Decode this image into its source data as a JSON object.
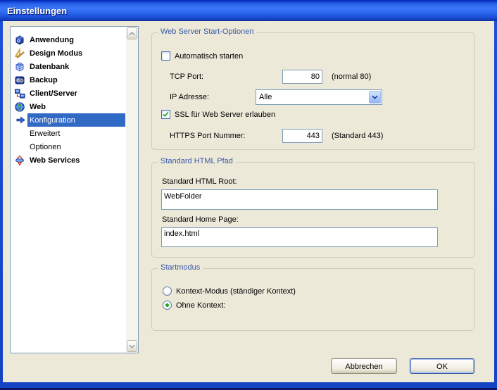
{
  "window": {
    "title": "Einstellungen"
  },
  "sidebar": {
    "items": [
      {
        "label": "Anwendung",
        "icon": "application-cube-icon",
        "level": 0,
        "selected": false
      },
      {
        "label": "Design Modus",
        "icon": "design-tools-icon",
        "level": 0,
        "selected": false
      },
      {
        "label": "Datenbank",
        "icon": "database-cube-icon",
        "level": 0,
        "selected": false
      },
      {
        "label": "Backup",
        "icon": "backup-disks-icon",
        "level": 0,
        "selected": false
      },
      {
        "label": "Client/Server",
        "icon": "client-server-icon",
        "level": 0,
        "selected": false
      },
      {
        "label": "Web",
        "icon": "globe-icon",
        "level": 0,
        "selected": false
      },
      {
        "label": "Konfiguration",
        "icon": "arrow-right-icon",
        "level": 1,
        "selected": true
      },
      {
        "label": "Erweitert",
        "icon": "",
        "level": 1,
        "selected": false
      },
      {
        "label": "Optionen",
        "icon": "",
        "level": 1,
        "selected": false
      },
      {
        "label": "Web Services",
        "icon": "web-services-icon",
        "level": 0,
        "selected": false
      }
    ]
  },
  "panel": {
    "web_server": {
      "title": "Web Server Start-Optionen",
      "auto_start": {
        "label": "Automatisch starten",
        "checked": false
      },
      "tcp_port": {
        "label": "TCP Port:",
        "value": "80",
        "note": "(normal 80)"
      },
      "ip_address": {
        "label": "IP Adresse:",
        "value": "Alle"
      },
      "ssl": {
        "label": "SSL für Web Server erlauben",
        "checked": true
      },
      "https_port": {
        "label": "HTTPS Port Nummer:",
        "value": "443",
        "note": "(Standard 443)"
      }
    },
    "html_path": {
      "title": "Standard HTML Pfad",
      "root": {
        "label": "Standard HTML Root:",
        "value": "WebFolder"
      },
      "home": {
        "label": "Standard Home Page:",
        "value": "index.html"
      }
    },
    "startmode": {
      "title": "Startmodus",
      "context_mode": {
        "label": "Kontext-Modus (ständiger Kontext)",
        "selected": false
      },
      "no_context": {
        "label": "Ohne Kontext:",
        "selected": true
      }
    }
  },
  "buttons": {
    "cancel": "Abbrechen",
    "ok": "OK"
  },
  "colors": {
    "dialog_bg": "#ece9d8",
    "titlebar_blue": "#2e6bf0",
    "selection_blue": "#316ac5",
    "group_label_blue": "#3a58a8",
    "check_green": "#21a121",
    "field_border": "#7f9db9"
  }
}
